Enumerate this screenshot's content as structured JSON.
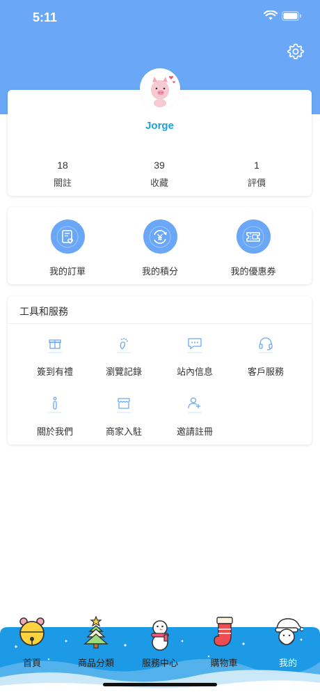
{
  "status_bar": {
    "time": "5:11"
  },
  "profile": {
    "username": "Jorge"
  },
  "stats": [
    {
      "value": "18",
      "label": "關註"
    },
    {
      "value": "39",
      "label": "收藏"
    },
    {
      "value": "1",
      "label": "評價"
    }
  ],
  "quick_actions": [
    {
      "label": "我的訂單",
      "icon": "order-icon"
    },
    {
      "label": "我的積分",
      "icon": "points-icon"
    },
    {
      "label": "我的優惠券",
      "icon": "coupon-icon"
    }
  ],
  "tools": {
    "title": "工具和服務",
    "items": [
      {
        "label": "簽到有禮",
        "icon": "gift-icon"
      },
      {
        "label": "瀏覽記錄",
        "icon": "footprint-icon"
      },
      {
        "label": "站內信息",
        "icon": "message-icon"
      },
      {
        "label": "客戶服務",
        "icon": "headset-icon"
      },
      {
        "label": "關於我們",
        "icon": "info-icon"
      },
      {
        "label": "商家入駐",
        "icon": "store-icon"
      },
      {
        "label": "邀請註冊",
        "icon": "add-user-icon"
      }
    ]
  },
  "tabbar": [
    {
      "label": "首頁",
      "icon": "bell-icon"
    },
    {
      "label": "商品分類",
      "icon": "tree-icon"
    },
    {
      "label": "服務中心",
      "icon": "snowman-icon"
    },
    {
      "label": "購物車",
      "icon": "stocking-icon"
    },
    {
      "label": "我的",
      "icon": "santa-icon"
    }
  ],
  "colors": {
    "header": "#6aa8f7",
    "accent": "#1ba1d6",
    "tabbar": "#1d9ae6"
  }
}
